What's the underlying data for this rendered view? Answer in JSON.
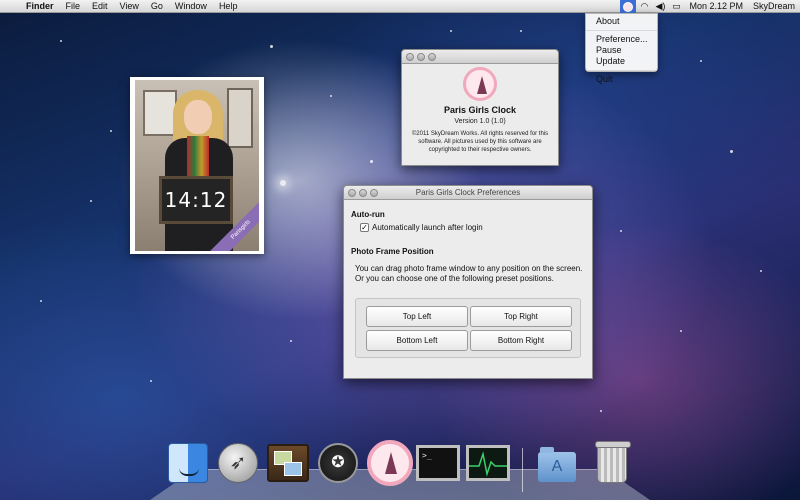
{
  "menubar": {
    "apple_icon": "apple-logo-icon",
    "app_name": "Finder",
    "menus": [
      "File",
      "Edit",
      "View",
      "Go",
      "Window",
      "Help"
    ],
    "clock": "Mon 2.12 PM",
    "user": "SkyDream"
  },
  "status_menu": {
    "items": [
      "About",
      "Preference...",
      "Pause Update",
      "Quit"
    ]
  },
  "photo_frame": {
    "chalkboard_time": "14:12",
    "ribbon_text": "Parisgirls"
  },
  "about_window": {
    "app_title": "Paris Girls Clock",
    "version": "Version 1.0 (1.0)",
    "copyright": "©2011 SkyDream Works.  All rights reserved for this software. All pictures used by this software are copyrighted to their respective owners."
  },
  "preferences": {
    "window_title": "Paris Girls Clock Preferences",
    "autorun_heading": "Auto-run",
    "autorun_checkbox": "Automatically launch after login",
    "autorun_checked": true,
    "frame_heading": "Photo Frame Position",
    "frame_desc_line1": "You can drag photo frame window to any position on the screen.",
    "frame_desc_line2": "Or you can choose one of the following preset positions.",
    "buttons": {
      "top_left": "Top Left",
      "top_right": "Top Right",
      "bottom_left": "Bottom Left",
      "bottom_right": "Bottom Right"
    }
  },
  "dock": {
    "items": [
      "Finder",
      "Launchpad",
      "iPhoto",
      "Dashboard",
      "Paris Girls Clock",
      "Terminal",
      "Activity Monitor",
      "Applications",
      "Trash"
    ]
  },
  "colors": {
    "menu_highlight": "#3b6fd6",
    "clock_pink": "#f2a8bc"
  }
}
